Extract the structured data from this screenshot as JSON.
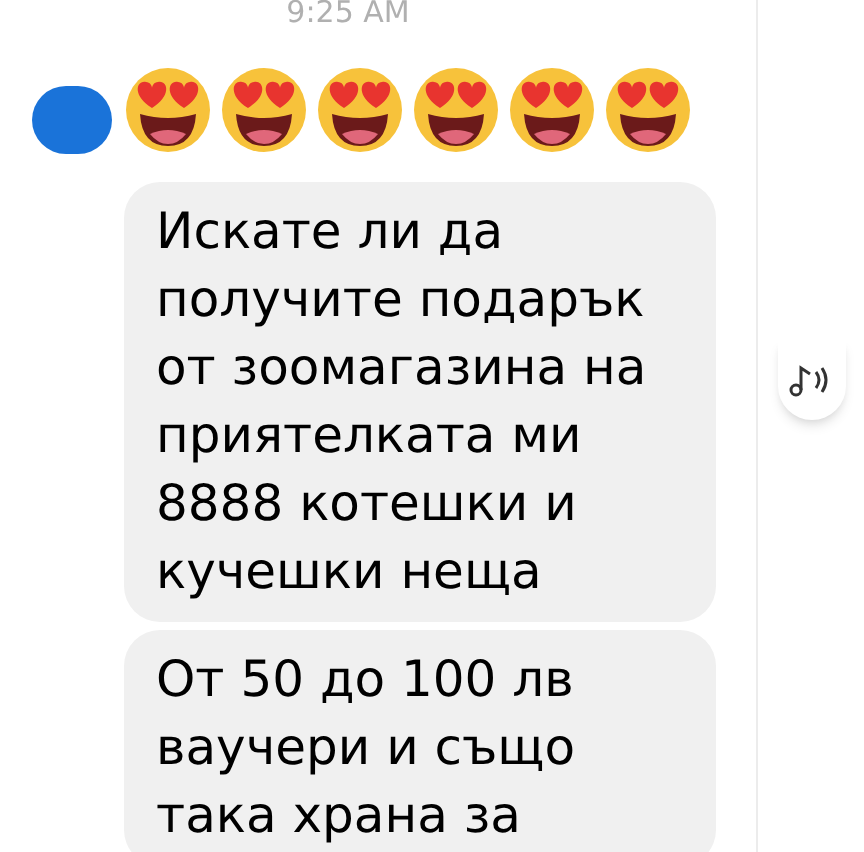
{
  "timestamp": "9:25 AM",
  "emoji_message": [
    {
      "kind": "heart_eyes"
    },
    {
      "kind": "heart_eyes"
    },
    {
      "kind": "heart_eyes"
    },
    {
      "kind": "heart_eyes"
    },
    {
      "kind": "heart_eyes"
    },
    {
      "kind": "heart_eyes"
    }
  ],
  "messages": [
    {
      "text": "Искате ли да получите подарък от зоомагазина на приятелката ми 8888 котешки и кучешки неща"
    },
    {
      "text": "От 50 до 100 лв ваучери и също така храна за"
    }
  ]
}
